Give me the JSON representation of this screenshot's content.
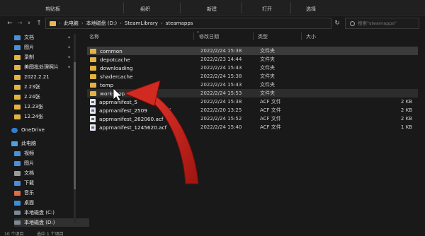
{
  "ribbon": {
    "groups": [
      "剪贴板",
      "组织",
      "新建",
      "打开",
      "选择"
    ]
  },
  "nav": {
    "back": "←",
    "forward": "→",
    "dropdown": "∨",
    "up": "↑",
    "breadcrumbs": [
      "此电脑",
      "本地磁盘 (D:)",
      "SteamLibrary",
      "steamapps"
    ],
    "refresh": "↻"
  },
  "search": {
    "placeholder": "搜索\"steamapps\""
  },
  "sidebar": {
    "quick": [
      {
        "label": "文档",
        "icon": "document-icon",
        "pinned": true
      },
      {
        "label": "图片",
        "icon": "pictures-icon",
        "pinned": true
      },
      {
        "label": "录制",
        "icon": "folder-icon",
        "pinned": true
      },
      {
        "label": "美图批处理照片",
        "icon": "folder-icon",
        "pinned": true
      },
      {
        "label": "2022.2.21",
        "icon": "folder-icon",
        "pinned": false
      },
      {
        "label": "2.23张",
        "icon": "folder-icon",
        "pinned": false
      },
      {
        "label": "2.24张",
        "icon": "folder-icon",
        "pinned": false
      },
      {
        "label": "12.23张",
        "icon": "folder-icon",
        "pinned": false
      },
      {
        "label": "12.24张",
        "icon": "folder-icon",
        "pinned": false
      }
    ],
    "onedrive": "OneDrive",
    "thispc": "此电脑",
    "pc_items": [
      {
        "label": "视频",
        "icon": "video-icon"
      },
      {
        "label": "图片",
        "icon": "pictures-icon"
      },
      {
        "label": "文档",
        "icon": "document-icon"
      },
      {
        "label": "下载",
        "icon": "download-icon"
      },
      {
        "label": "音乐",
        "icon": "music-icon"
      },
      {
        "label": "桌面",
        "icon": "desktop-icon"
      },
      {
        "label": "本地磁盘 (C:)",
        "icon": "drive-icon"
      },
      {
        "label": "本地磁盘 (D:)",
        "icon": "drive-icon"
      }
    ]
  },
  "columns": {
    "name": "名称",
    "date": "修改日期",
    "type": "类型",
    "size": "大小",
    "sort_caret": "^"
  },
  "files": [
    {
      "name": "common",
      "date": "2022/2/24 15:38",
      "type": "文件夹",
      "size": "",
      "kind": "folder",
      "state": "selected"
    },
    {
      "name": "depotcache",
      "date": "2022/2/23 14:44",
      "type": "文件夹",
      "size": "",
      "kind": "folder",
      "state": ""
    },
    {
      "name": "downloading",
      "date": "2022/2/24 15:43",
      "type": "文件夹",
      "size": "",
      "kind": "folder",
      "state": ""
    },
    {
      "name": "shadercache",
      "date": "2022/2/24 15:38",
      "type": "文件夹",
      "size": "",
      "kind": "folder",
      "state": ""
    },
    {
      "name": "temp",
      "date": "2022/2/24 15:43",
      "type": "文件夹",
      "size": "",
      "kind": "folder",
      "state": ""
    },
    {
      "name": "workshop",
      "date": "2022/2/24 15:53",
      "type": "文件夹",
      "size": "",
      "kind": "folder",
      "state": "hover"
    },
    {
      "name": "appmanifest_5",
      "date": "2022/2/24 15:38",
      "type": "ACF 文件",
      "size": "2 KB",
      "kind": "acf",
      "state": ""
    },
    {
      "name": "appmanifest_2509",
      "date": "2022/2/20 13:25",
      "type": "ACF 文件",
      "size": "2 KB",
      "kind": "acf",
      "state": ""
    },
    {
      "name": "appmanifest_262060.acf",
      "date": "2022/2/24 15:52",
      "type": "ACF 文件",
      "size": "2 KB",
      "kind": "acf",
      "state": ""
    },
    {
      "name": "appmanifest_1245620.acf",
      "date": "2022/2/24 15:40",
      "type": "ACF 文件",
      "size": "1 KB",
      "kind": "acf",
      "state": ""
    }
  ],
  "partial_labels": {
    "acf_suffix": "acf"
  },
  "status": {
    "count": "10 个项目",
    "selected": "选中 1 个项目"
  },
  "colors": {
    "arrow": "#c0201a",
    "folder": "#e3b341",
    "selected_row": "#3b3b3b"
  }
}
